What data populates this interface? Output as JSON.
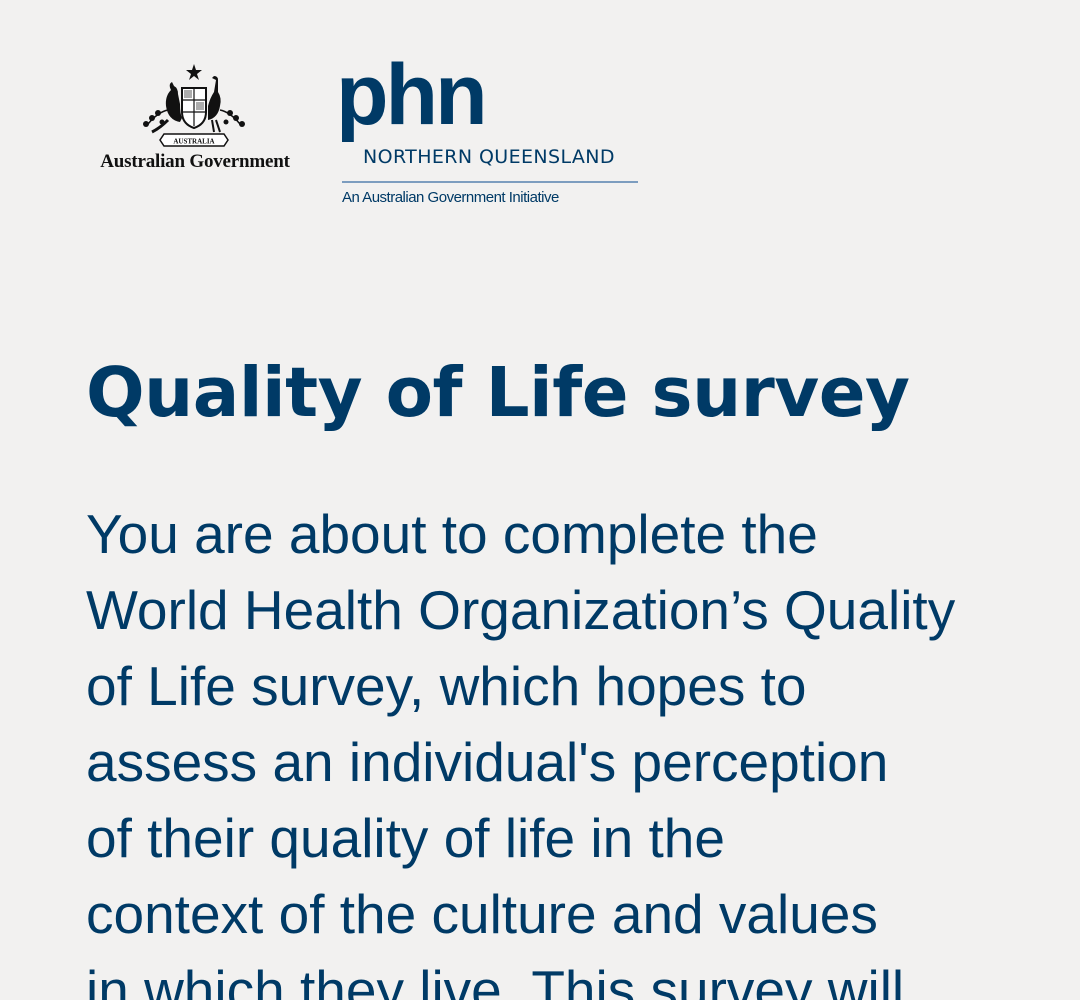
{
  "logos": {
    "australian_government": {
      "label": "Australian Government",
      "crest_icon": "coat-of-arms-icon",
      "crest_banner_text": "AUSTRALIA"
    },
    "phn": {
      "wordmark": "phn",
      "region": "NORTHERN QUEENSLAND",
      "initiative": "An Australian Government Initiative"
    }
  },
  "page": {
    "title": "Quality of Life survey",
    "intro_lines": [
      "You are about to complete the",
      "World Health Organization’s Quality",
      "of Life survey, which hopes to",
      "assess an individual's perception",
      "of their quality of life in the",
      "context of the culture and values",
      "in which they live. This survey will"
    ]
  },
  "colors": {
    "background": "#f2f1f0",
    "brand_navy": "#003a66",
    "rule_blue": "#7d9dbf"
  }
}
